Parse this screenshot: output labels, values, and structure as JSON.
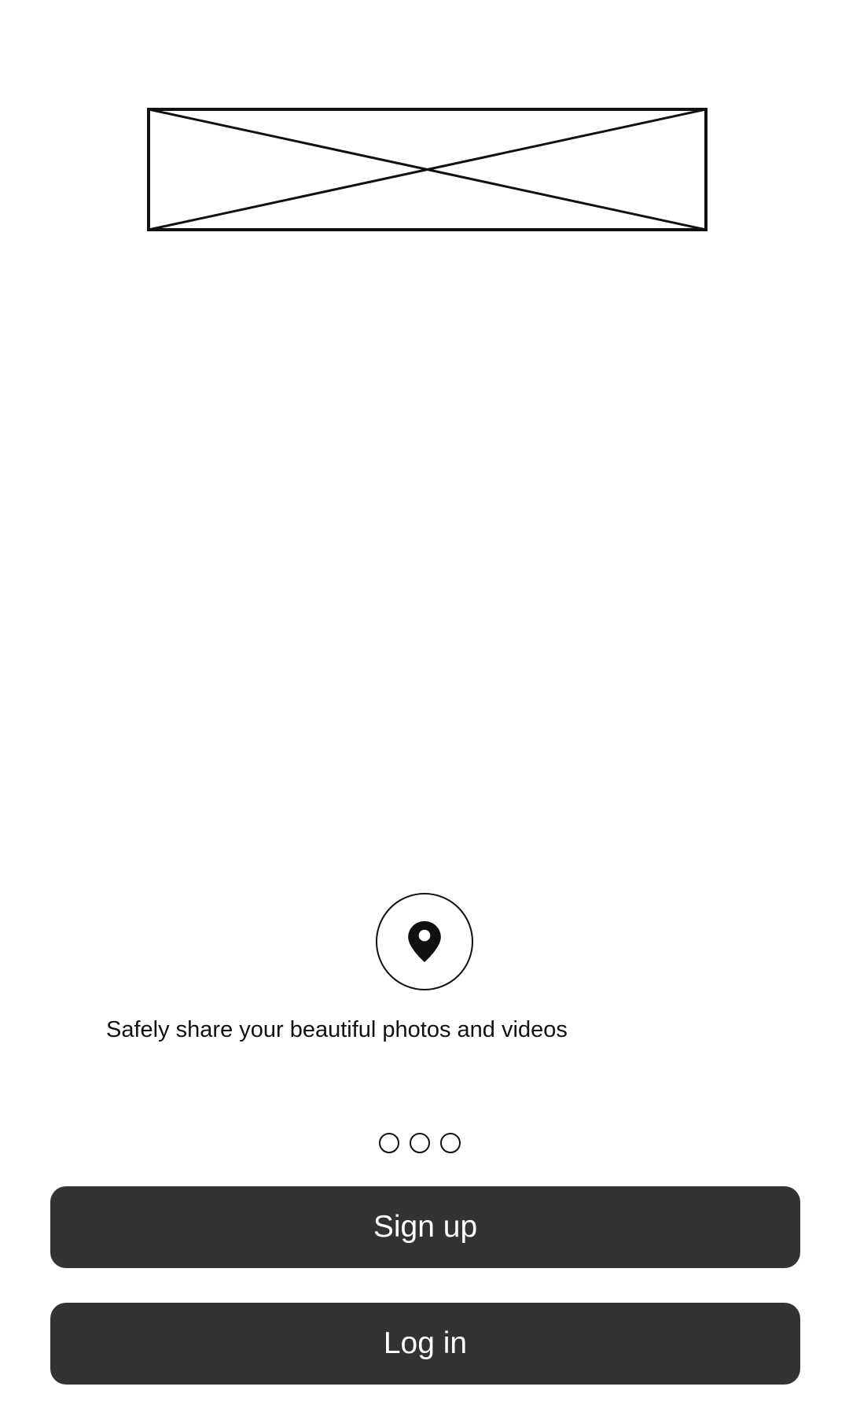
{
  "logo": {
    "icon": "image-placeholder-icon"
  },
  "feature": {
    "icon": "location-pin-icon",
    "tagline": "Safely share your beautiful photos and videos"
  },
  "pager": {
    "pages": 3,
    "dots": [
      "",
      "",
      ""
    ]
  },
  "actions": {
    "signup_label": "Sign up",
    "login_label": "Log in"
  },
  "colors": {
    "button_background": "#333333",
    "button_text": "#ffffff",
    "outline": "#111111",
    "background": "#ffffff"
  }
}
